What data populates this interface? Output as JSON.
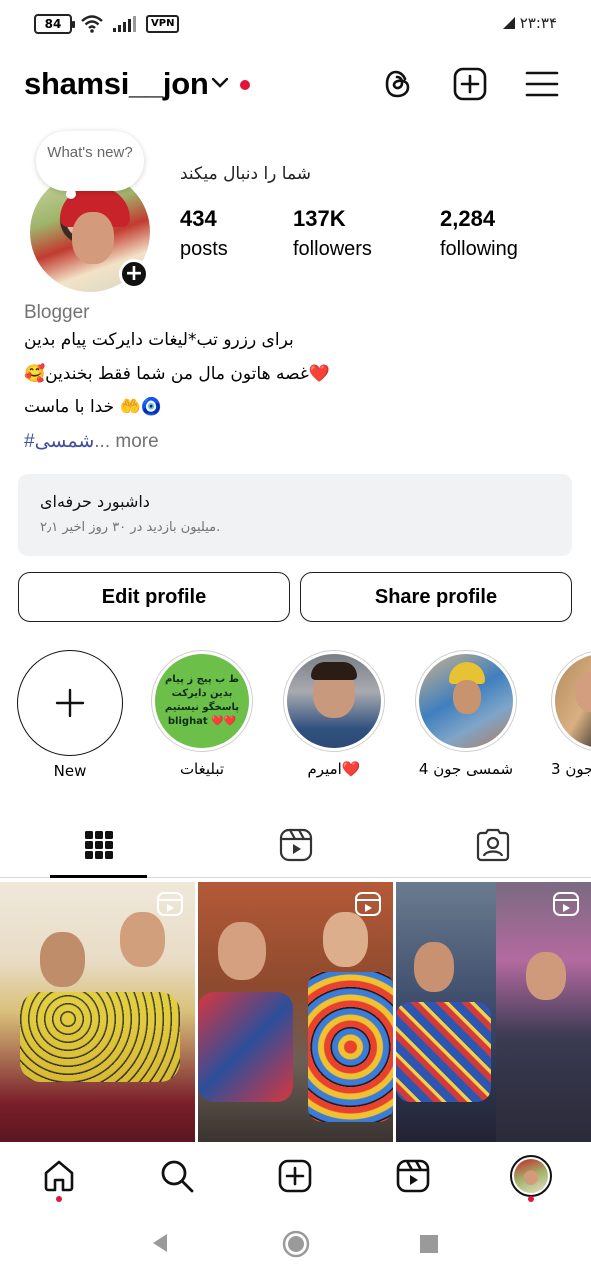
{
  "status_bar": {
    "battery": "84",
    "vpn": "VPN",
    "time": "۲۳:۳۴",
    "icons": [
      "battery-icon",
      "wifi-icon",
      "signal-icon",
      "vpn-icon",
      "nfc-icon"
    ]
  },
  "header": {
    "username": "shamsi__jon",
    "icons": [
      "chevron-down-icon",
      "threads-icon",
      "add-post-icon",
      "menu-icon"
    ]
  },
  "profile": {
    "note_bubble": "What's new?",
    "follows_text": "شما را دنبال میکند",
    "stats": [
      {
        "num": "434",
        "label": "posts"
      },
      {
        "num": "137K",
        "label": "followers"
      },
      {
        "num": "2,284",
        "label": "following"
      }
    ],
    "category": "Blogger",
    "bio_lines": [
      "برای رزرو تب*لیغات دایرکت پیام بدین",
      "❤️غصه هاتون مال من شما فقط بخندین🥰",
      "🧿🤲 خدا با ماست"
    ],
    "bio_tag": "#شمسی",
    "bio_more_prefix": "...",
    "bio_more": " more"
  },
  "dashboard": {
    "title": "داشبورد حرفه‌ای",
    "subtitle": "۲٫۱ میلیون بازدید در ۳۰ روز اخیر."
  },
  "buttons": {
    "edit": "Edit profile",
    "share": "Share profile"
  },
  "highlights": [
    {
      "label": "New",
      "type": "new"
    },
    {
      "label": "تبلیغات",
      "type": "ad",
      "text": "ط ب پیج ز پیام بدین دایرکت پاسخگو نیستیم ❤️❤️ blighat"
    },
    {
      "label": "امیرم❤️",
      "type": "photo"
    },
    {
      "label": "شمسی جون 4",
      "type": "photo"
    },
    {
      "label": "جون 3",
      "type": "photo"
    }
  ],
  "tabs": [
    "grid-icon",
    "reels-icon",
    "tagged-icon"
  ],
  "bottom_nav": [
    "home-icon",
    "search-icon",
    "create-icon",
    "reels-icon",
    "profile-avatar"
  ],
  "colors": {
    "accent_red": "#e2143c",
    "tag_blue": "#4150a3",
    "muted": "#737373",
    "dashboard_bg": "#f1f2f4"
  }
}
